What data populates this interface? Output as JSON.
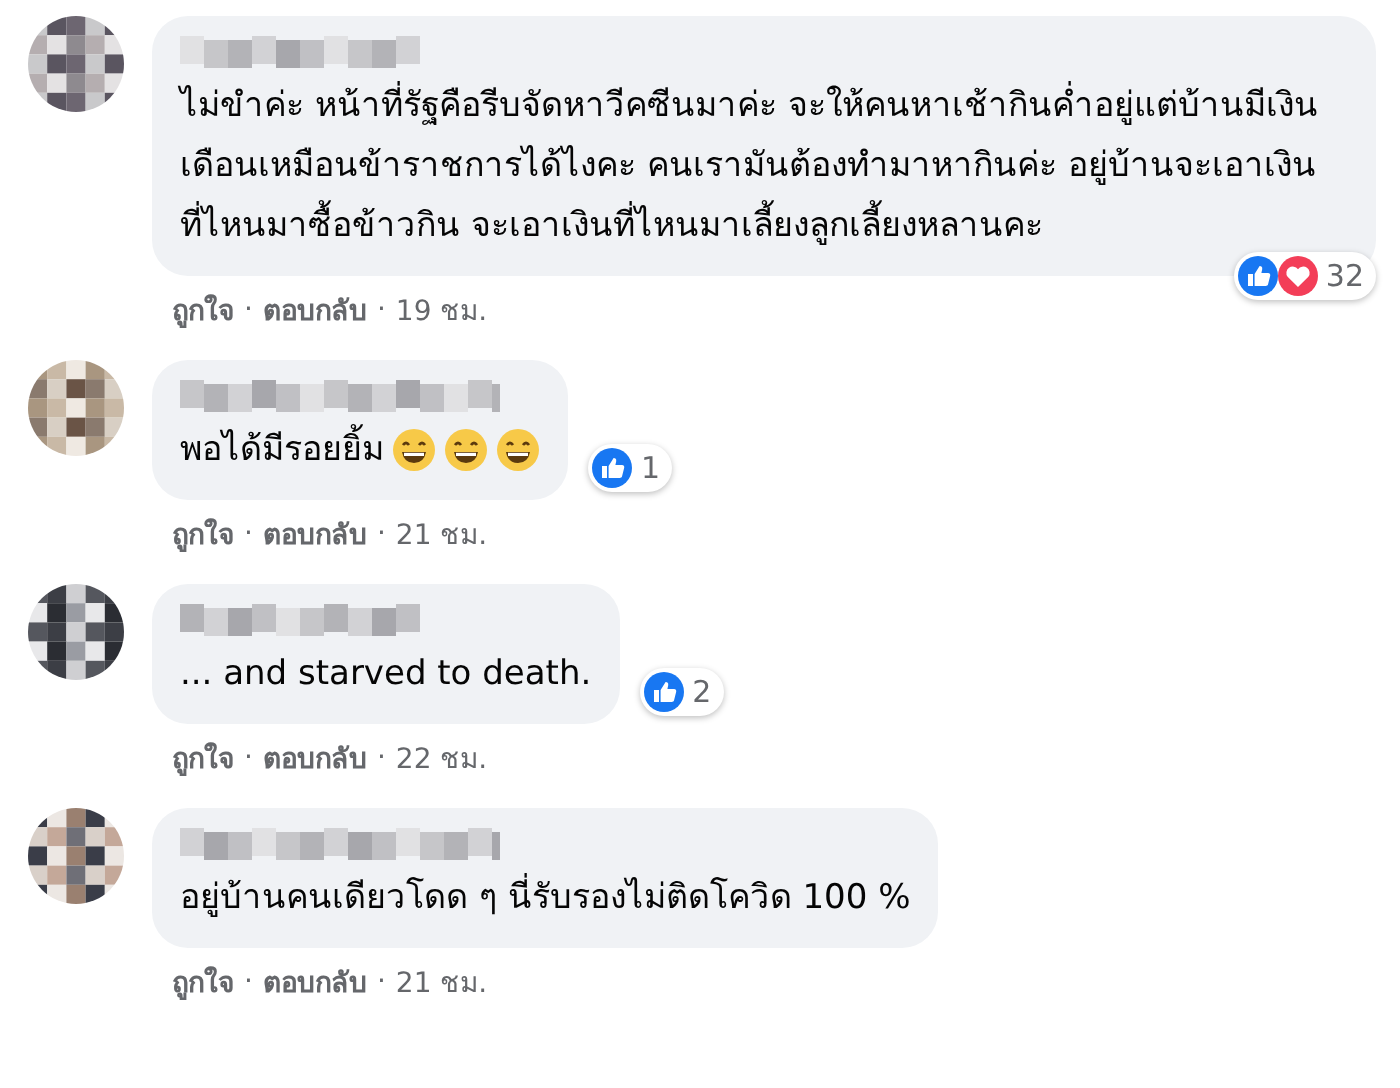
{
  "separator": "·",
  "comments": [
    {
      "text": "ไม่ขำค่ะ หน้าที่รัฐคือรีบจัดหาวีคซีนมาค่ะ จะให้คนหาเช้ากินค่ำอยู่แต่บ้านมีเงินเดือนเหมือนข้าราชการได้ไงคะ คนเรามันต้องทำมาหากินค่ะ อยู่บ้านจะเอาเงินที่ไหนมาซื้อข้าวกิน จะเอาเงินที่ไหนมาเลี้ยงลูกเลี้ยงหลานคะ",
      "reactions": {
        "icons": [
          {
            "kind": "like"
          },
          {
            "kind": "love"
          }
        ],
        "count": "32"
      },
      "actions": [
        "ถูกใจ",
        "ตอบกลับ"
      ],
      "time": "19 ชม."
    },
    {
      "text": "พอได้มีรอยยิ้ม",
      "emojis": [
        {
          "kind": "grin"
        },
        {
          "kind": "grin"
        },
        {
          "kind": "grin"
        }
      ],
      "reactions": {
        "icons": [
          {
            "kind": "like"
          }
        ],
        "count": "1"
      },
      "actions": [
        "ถูกใจ",
        "ตอบกลับ"
      ],
      "time": "21 ชม."
    },
    {
      "text": "... and starved to death.",
      "reactions": {
        "icons": [
          {
            "kind": "like"
          }
        ],
        "count": "2"
      },
      "actions": [
        "ถูกใจ",
        "ตอบกลับ"
      ],
      "time": "22 ชม."
    },
    {
      "text": "อยู่บ้านคนเดียวโดด ๆ นี่รับรองไม่ติดโควิด 100 %",
      "actions": [
        "ถูกใจ",
        "ตอบกลับ"
      ],
      "time": "21 ชม."
    }
  ]
}
